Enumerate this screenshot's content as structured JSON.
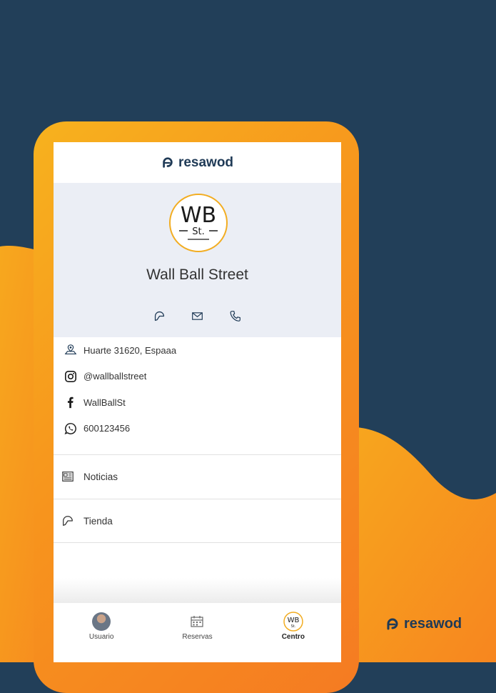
{
  "app": {
    "brand": "resawod",
    "brand_icon": "resawod-logo-icon",
    "colors": {
      "navy": "#223f59",
      "orange": "#f7941d",
      "orange_light": "#f7b21e",
      "profile_bg": "#ebeef5"
    }
  },
  "profile": {
    "logo_text": "WB St.",
    "name": "Wall Ball Street",
    "actions": [
      {
        "icon": "shop-icon",
        "label": "Tienda"
      },
      {
        "icon": "mail-icon",
        "label": "Email"
      },
      {
        "icon": "phone-icon",
        "label": "Teléfono"
      }
    ]
  },
  "info": [
    {
      "icon": "location-icon",
      "text": "Huarte 31620, Espaaa"
    },
    {
      "icon": "instagram-icon",
      "text": "@wallballstreet"
    },
    {
      "icon": "facebook-icon",
      "text": "WallBallSt"
    },
    {
      "icon": "whatsapp-icon",
      "text": "600123456"
    }
  ],
  "menu": [
    {
      "icon": "news-icon",
      "label": "Noticias"
    },
    {
      "icon": "shop-icon",
      "label": "Tienda"
    }
  ],
  "tabs": [
    {
      "icon": "avatar",
      "label": "Usuario",
      "active": false
    },
    {
      "icon": "calendar-icon",
      "label": "Reservas",
      "active": false
    },
    {
      "icon": "club-logo",
      "label": "Centro",
      "active": true
    }
  ],
  "corner_brand": "resawod"
}
